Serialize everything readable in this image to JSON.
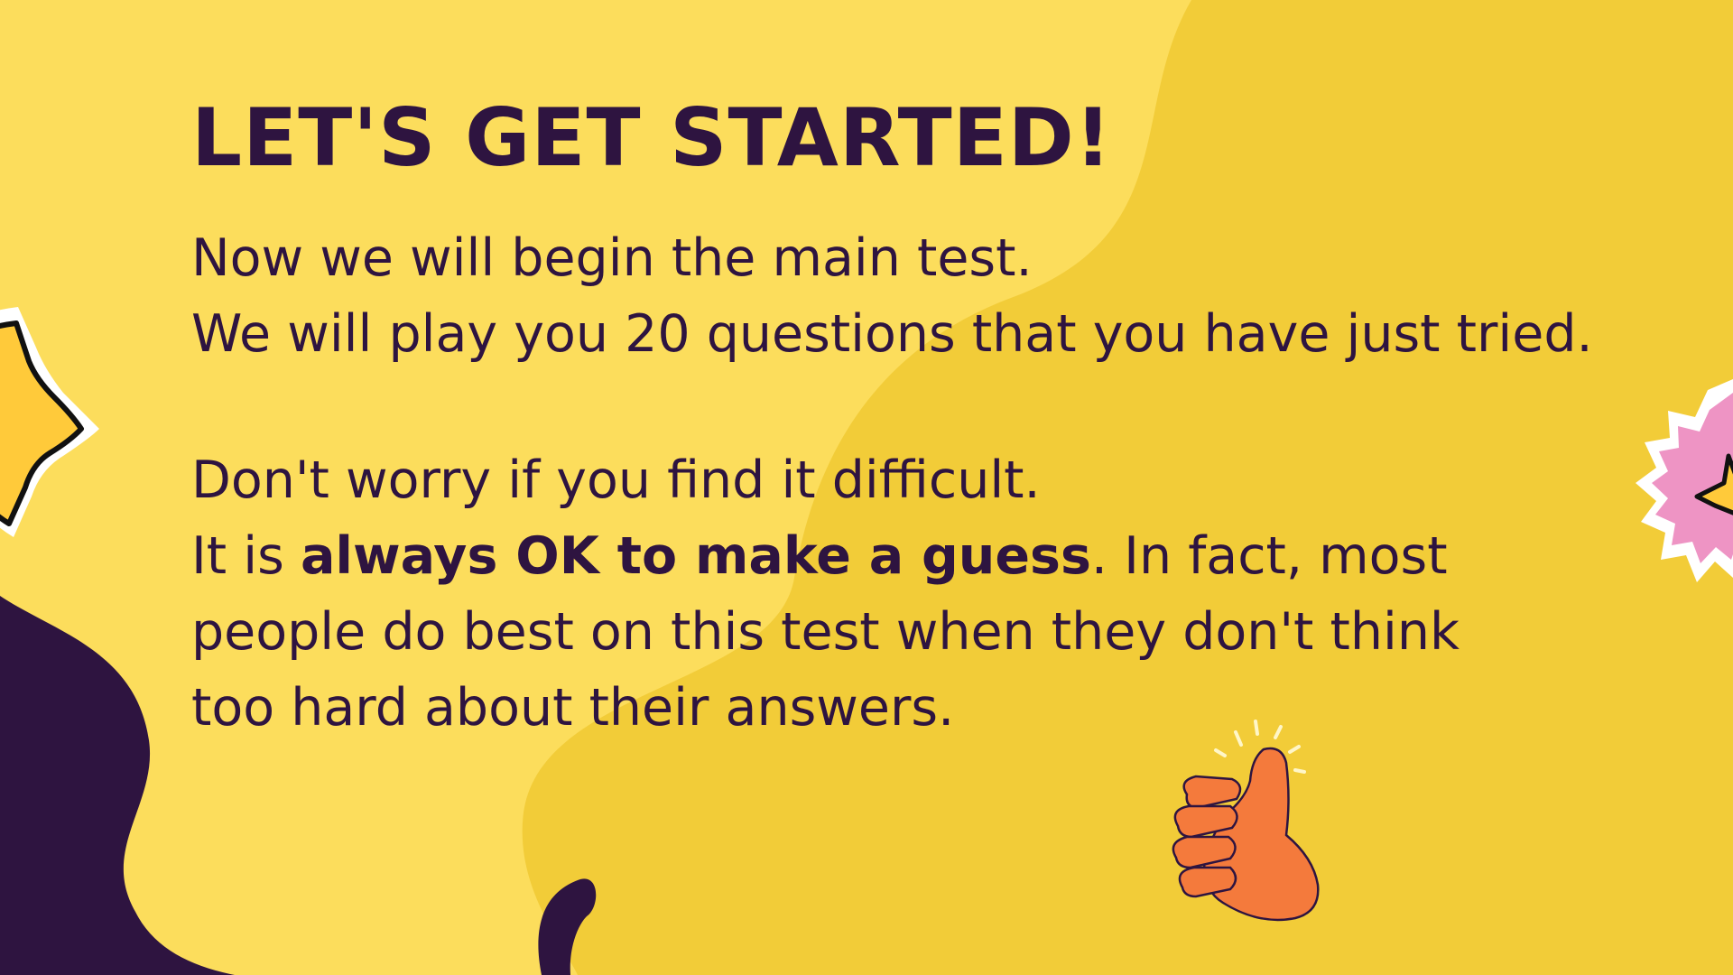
{
  "colors": {
    "background": "#FCDD5C",
    "blob": "#F2CC38",
    "dark": "#2E1440",
    "star_left": "#FFCA3A",
    "badge_right": "#EE94C4",
    "thumb": "#F47A3C"
  },
  "slide": {
    "title": "LET'S GET STARTED!",
    "intro_line1": "Now we will begin the main test.",
    "intro_line2": "We will play you 20 questions that you have just tried.",
    "worry_line": "Don't worry if you find it difficult.",
    "guess_prefix": "It is ",
    "guess_emphasis": "always OK to make a guess",
    "guess_suffix": ". In fact, most",
    "guess_line2": "people do best on this test when they don't think",
    "guess_line3": "too hard about their answers."
  },
  "decorations": {
    "left_icon": "star-icon",
    "right_icon": "star-badge-icon",
    "thumb_icon": "thumbs-up-icon"
  }
}
